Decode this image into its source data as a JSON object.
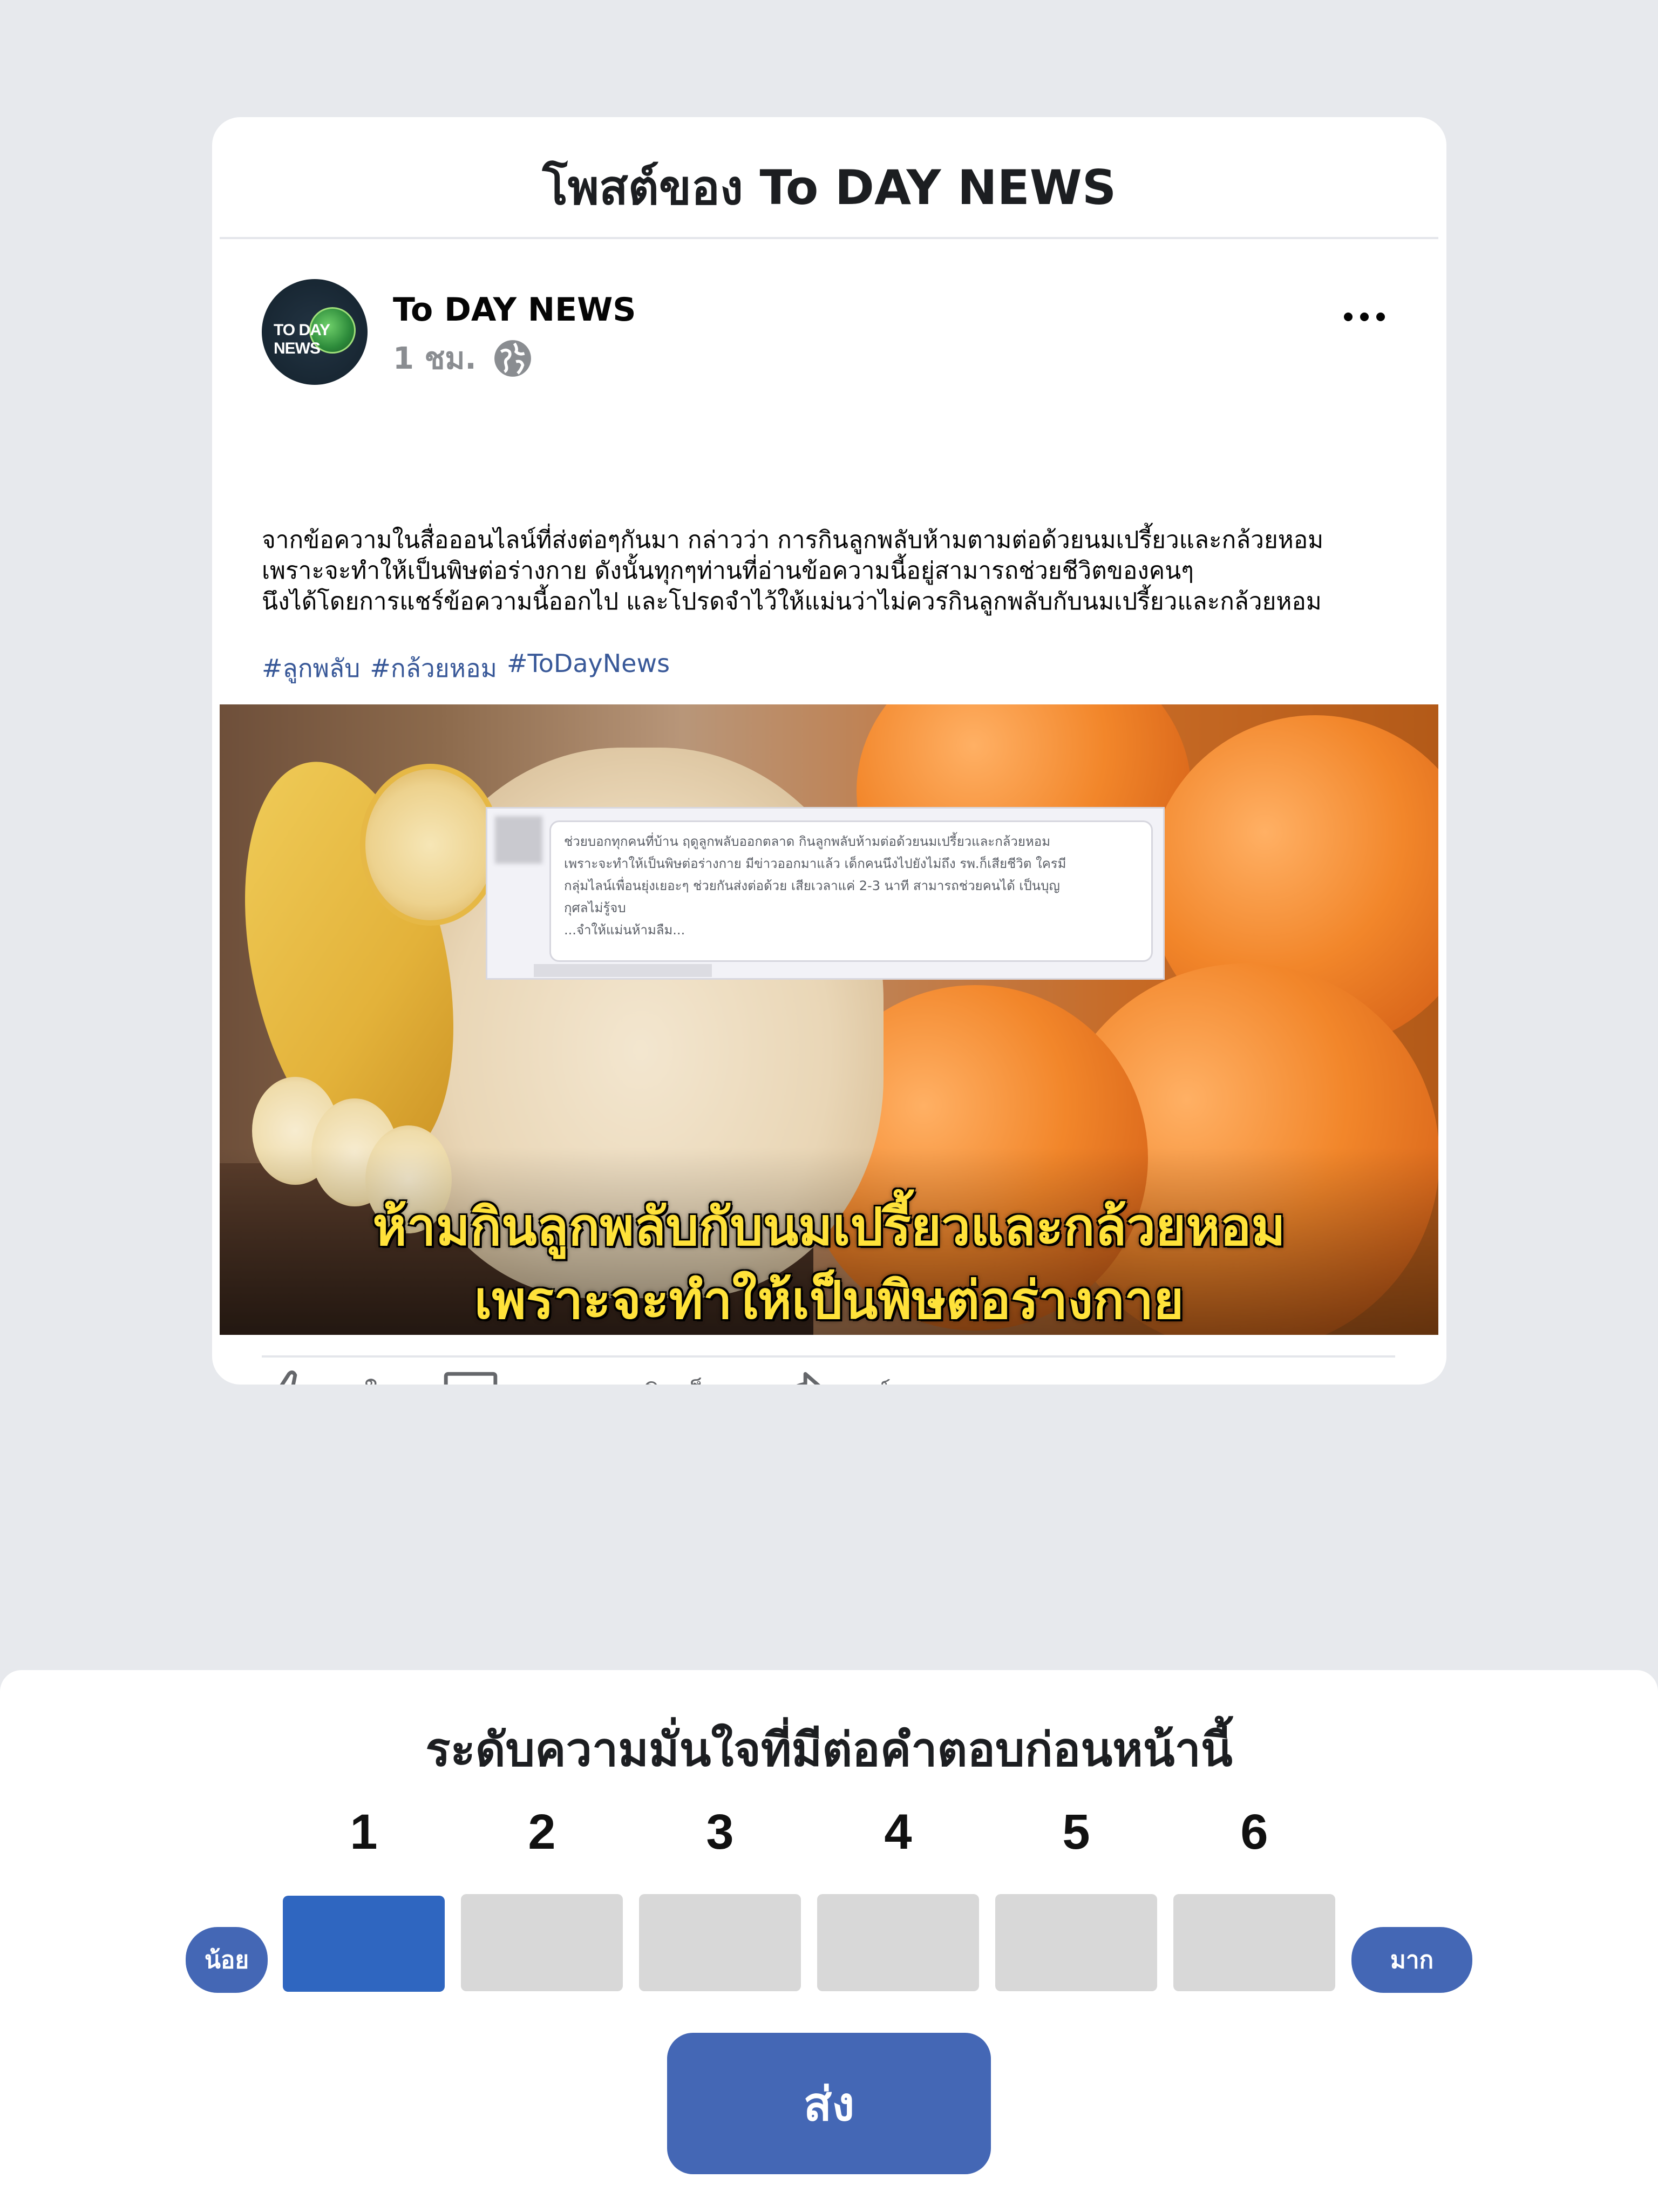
{
  "post_dialog": {
    "title": "โพสต์ของ To DAY NEWS",
    "avatar_text": "TO DAY NEWS",
    "page_name": "To DAY NEWS",
    "time": "1 ชม.",
    "privacy_icon": "globe-icon",
    "more_icon": "more-horizontal-icon",
    "text_lines": [
      "จากข้อความในสื่อออนไลน์ที่ส่งต่อๆกันมา กล่าวว่า การกินลูกพลับห้ามตามต่อด้วยนมเปรี้ยวและกล้วยหอม",
      "เพราะจะทำให้เป็นพิษต่อร่างกาย ดังนั้นทุกๆท่านที่อ่านข้อความนี้อยู่สามารถช่วยชีวิตของคนๆ",
      "นึงได้โดยการแชร์ข้อความนี้ออกไป และโปรดจำไว้ให้แม่นว่าไม่ควรกินลูกพลับกับนมเปรี้ยวและกล้วยหอม"
    ],
    "hashtags": [
      "#ลูกพลับ",
      "#กล้วยหอม",
      "#ToDayNews"
    ],
    "image": {
      "quote_lines": [
        "ช่วยบอกทุกคนที่บ้าน ฤดูลูกพลับออกตลาด กินลูกพลับห้ามต่อด้วยนมเปรี้ยวและกล้วยหอม",
        "เพราะจะทำให้เป็นพิษต่อร่างกาย มีข่าวออกมาแล้ว เด็กคนนึงไปยังไม่ถึง รพ.ก็เสียชีวิต ใครมี",
        "กลุ่มไลน์เพื่อนยุ่งเยอะๆ ช่วยกันส่งต่อด้วย เสียเวลาแค่ 2-3 นาที สามารถช่วยคนได้ เป็นบุญ",
        "กุศลไม่รู้จบ",
        "...จำให้แม่นห้ามลืม..."
      ],
      "caption_lines": [
        "ห้ามกินลูกพลับกับนมเปรี้ยวและกล้วยหอม",
        "เพราะจะทำให้เป็นพิษต่อร่างกาย"
      ]
    },
    "actions": {
      "like": "ถูกใจ",
      "comment": "แสดงความคิดเห็น",
      "share": "แชร์"
    }
  },
  "confidence_panel": {
    "title": "ระดับความมั่นใจที่มีต่อคำตอบก่อนหน้านี้",
    "scale": [
      "1",
      "2",
      "3",
      "4",
      "5",
      "6"
    ],
    "selected_value": 1,
    "low_label": "น้อย",
    "high_label": "มาก",
    "submit_label": "ส่ง"
  },
  "colors": {
    "background": "#e7e9ed",
    "accent": "#4467b5",
    "selected": "#2f66c0",
    "unselected": "#d8d8d8",
    "hashtag": "#385898",
    "caption": "#ffe23a"
  }
}
